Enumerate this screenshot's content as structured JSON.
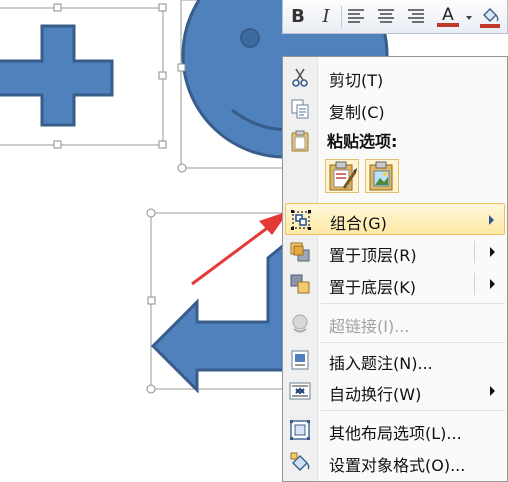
{
  "mini_toolbar": {
    "bold": "B",
    "italic": "I",
    "font_color_letter": "A",
    "font_color": "#c0392b",
    "icons": [
      "align-left-icon",
      "align-center-icon",
      "align-right-icon",
      "font-color-icon",
      "fill-bucket-icon"
    ]
  },
  "menu": {
    "cut": "剪切(T)",
    "copy": "复制(C)",
    "paste_header": "粘贴选项:",
    "group": "组合(G)",
    "bring_front": "置于顶层(R)",
    "send_back": "置于底层(K)",
    "hyperlink": "超链接(I)...",
    "insert_caption": "插入题注(N)...",
    "wrap_text": "自动换行(W)",
    "more_layout": "其他布局选项(L)...",
    "format_object": "设置对象格式(O)..."
  },
  "colors": {
    "shape_fill": "#4f81bd",
    "shape_outline": "#385d8a",
    "highlight": "#fde8a4",
    "arrow": "#e53935"
  }
}
